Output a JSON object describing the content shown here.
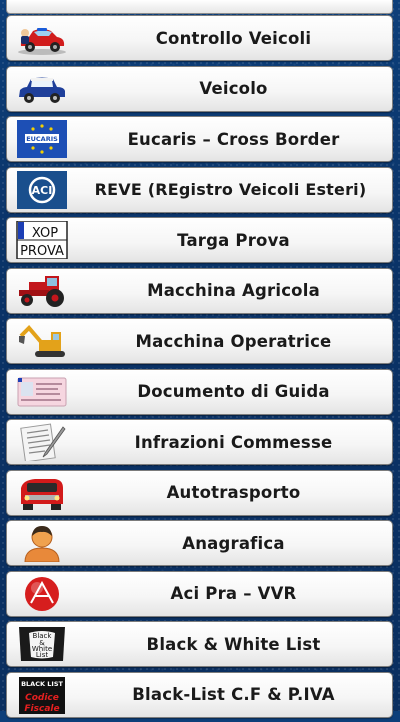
{
  "menu": {
    "items": [
      {
        "label": "Controllo Veicoli",
        "icon": "police-car-icon"
      },
      {
        "label": "Veicolo",
        "icon": "mini-car-icon"
      },
      {
        "label": "Eucaris – Cross Border",
        "icon": "eucaris-flag-icon",
        "icon_text": "EUCARIS"
      },
      {
        "label": "REVE (REgistro Veicoli Esteri)",
        "icon": "aci-logo-icon",
        "icon_text": "ACI"
      },
      {
        "label": "Targa Prova",
        "icon": "plate-prova-icon",
        "icon_text_top": "XOP",
        "icon_text_bottom": "PROVA"
      },
      {
        "label": "Macchina Agricola",
        "icon": "tractor-icon"
      },
      {
        "label": "Macchina Operatrice",
        "icon": "excavator-icon"
      },
      {
        "label": "Documento di Guida",
        "icon": "driving-license-icon"
      },
      {
        "label": "Infrazioni Commesse",
        "icon": "document-pen-icon"
      },
      {
        "label": "Autotrasporto",
        "icon": "truck-icon"
      },
      {
        "label": "Anagrafica",
        "icon": "person-icon"
      },
      {
        "label": "Aci Pra – VVR",
        "icon": "aci-pra-icon"
      },
      {
        "label": "Black & White List",
        "icon": "black-white-list-icon",
        "icon_text": [
          "Black",
          "&",
          "White",
          "List"
        ]
      },
      {
        "label": "Black-List C.F & P.IVA",
        "icon": "black-list-cf-icon",
        "icon_text": [
          "BLACK LIST",
          "Codice",
          "Fiscale"
        ]
      }
    ]
  },
  "colors": {
    "background": "#0a3266",
    "button": "#f4f4f4",
    "text": "#1a1a1a",
    "eu_blue": "#1d4fb5",
    "eu_star": "#f5d000"
  }
}
